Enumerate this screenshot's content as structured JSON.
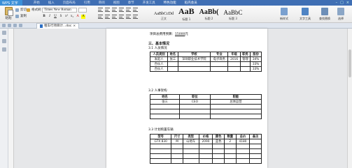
{
  "app": {
    "name": "WPS 文字"
  },
  "menu": {
    "tabs": [
      "开始",
      "插入",
      "页面布局",
      "引用",
      "审阅",
      "视图",
      "章节",
      "开发工具",
      "特色功能",
      "稻壳会员"
    ]
  },
  "ribbon": {
    "paste_label": "粘贴",
    "cut_label": "剪切",
    "copy_label": "复制",
    "format_painter_label": "格式刷",
    "font_name": "Times New Roman",
    "font_size": "",
    "styles": [
      {
        "sample": "AaBbCcDd",
        "name": "正文"
      },
      {
        "sample": "AaB",
        "name": "标题 1"
      },
      {
        "sample": "AaBb(",
        "name": "标题 2"
      },
      {
        "sample": "AaBbC",
        "name": "标题 3"
      }
    ],
    "new_style_label": "新样式",
    "text_tools_label": "文字工具",
    "find_replace_label": "查找替换",
    "select_label": "选择"
  },
  "tabs": {
    "doc_tab": "租车行项目计...doc"
  },
  "document": {
    "budget_label": "项目总费用预算：",
    "budget_value": "15000",
    "budget_unit": "元",
    "section_title": "三、基本情况",
    "sub1": "3.1 人员情况",
    "table1": {
      "headers": [
        "人员类别",
        "姓名",
        "学校",
        "专业",
        "年级",
        "职务",
        "股份"
      ],
      "rows": [
        [
          "发起人",
          "张三",
          "深圳职业技术学院",
          "电子商务",
          "2016",
          "管理",
          "34%"
        ],
        [
          "合伙人",
          "",
          "",
          "",
          "",
          "",
          "33%"
        ],
        [
          "合伙人",
          "",
          "",
          "",
          "",
          "",
          "33%"
        ]
      ]
    },
    "sub2": "3.2 人事架构",
    "table2": {
      "headers": [
        "姓名",
        "职位",
        "职能"
      ],
      "rows": [
        [
          "张三",
          "CEO",
          "总体运营"
        ],
        [
          "",
          "",
          ""
        ],
        [
          "",
          "",
          ""
        ],
        [
          "",
          "",
          ""
        ]
      ]
    },
    "sub3": "3.3 计划购置车辆",
    "table3": {
      "headers": [
        "型号",
        "尺寸",
        "类型",
        "价格",
        "颜色",
        "数量",
        "总价",
        "备注"
      ],
      "rows": [
        [
          "GTX 830",
          "M",
          "山地车",
          "2090",
          "蓝色",
          "2",
          "4180",
          ""
        ],
        [
          "",
          "",
          "",
          "",
          "",
          "",
          "",
          ""
        ],
        [
          "",
          "",
          "",
          "",
          "",
          "",
          "",
          ""
        ],
        [
          "",
          "",
          "",
          "",
          "",
          "",
          "",
          ""
        ],
        [
          "",
          "",
          "",
          "",
          "",
          "",
          "",
          ""
        ]
      ]
    }
  }
}
